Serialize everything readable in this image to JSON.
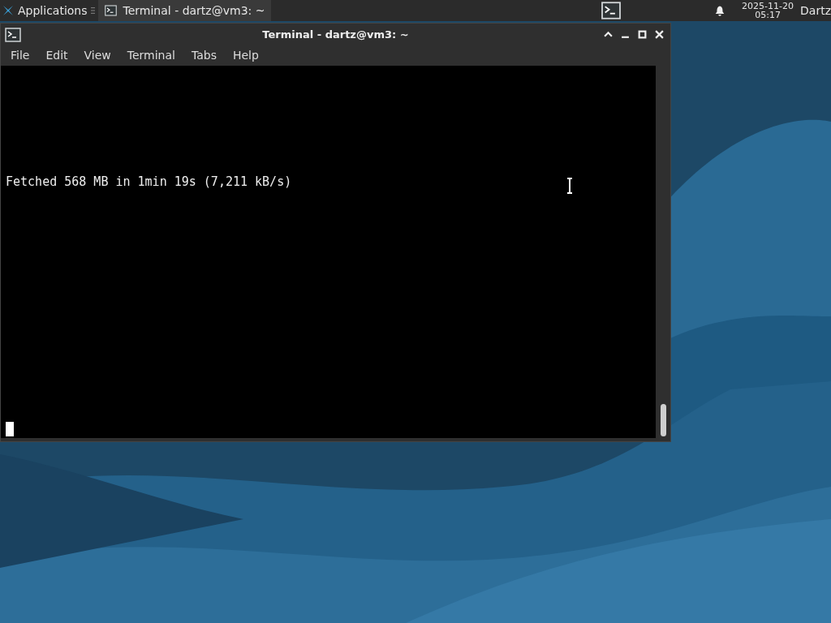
{
  "panel": {
    "applications": "Applications",
    "tasks": [
      {
        "title": "Terminal - dartz@vm3: ~",
        "selected": true
      }
    ],
    "date": "2025-11-20",
    "time": "05:17",
    "user": "Dartz"
  },
  "window": {
    "title": "Terminal - dartz@vm3: ~",
    "menu": [
      "File",
      "Edit",
      "View",
      "Terminal",
      "Tabs",
      "Help"
    ]
  },
  "terminal": {
    "lines": [
      "Fetched 568 MB in 1min 19s (7,211 kB/s)"
    ]
  }
}
